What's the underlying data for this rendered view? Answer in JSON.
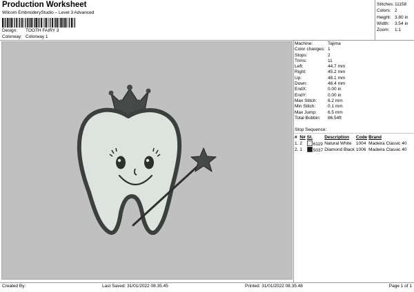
{
  "header": {
    "title": "Production Worksheet",
    "subtitle": "Wilcom EmbroideryStudio – Level 3 Advanced"
  },
  "design": {
    "label": "Design:",
    "value": "TOOTH FAIRY 3"
  },
  "colorway": {
    "label": "Colorway:",
    "value": "Colorway 1"
  },
  "stats": [
    {
      "label": "Stitches:",
      "value": "11158"
    },
    {
      "label": "Colors:",
      "value": "2"
    },
    {
      "label": "Height:",
      "value": "3.80 in"
    },
    {
      "label": "Width:",
      "value": "3.54 in"
    },
    {
      "label": "Zoom:",
      "value": "1:1"
    }
  ],
  "info": [
    {
      "label": "Machine:",
      "value": "Tajima"
    },
    {
      "label": "Color changes:",
      "value": "1"
    },
    {
      "label": "Stops:",
      "value": "2"
    },
    {
      "label": "Trims:",
      "value": "11"
    },
    {
      "label": "Left:",
      "value": "44.7 mm"
    },
    {
      "label": "Right:",
      "value": "45.2 mm"
    },
    {
      "label": "Up:",
      "value": "48.1 mm"
    },
    {
      "label": "Down:",
      "value": "48.4 mm"
    },
    {
      "label": "EndX:",
      "value": "0.00 in"
    },
    {
      "label": "EndY:",
      "value": "0.00 in"
    },
    {
      "label": "Max Stitch:",
      "value": "6.2 mm"
    },
    {
      "label": "Min Stitch:",
      "value": "0.1 mm"
    },
    {
      "label": "Max Jump:",
      "value": "6.5 mm"
    },
    {
      "label": "Total Bobbin:",
      "value": "86.54ft"
    }
  ],
  "stop_sequence": {
    "label": "Stop Sequence:",
    "headers": [
      "#",
      "N#",
      "St.",
      "Description",
      "Code",
      "Brand"
    ],
    "rows": [
      {
        "num": "1.",
        "n": "2",
        "swatch": "#e8ede6",
        "st": "6119",
        "desc": "Natural White",
        "code": "1004",
        "brand": "Madeira Classic 40"
      },
      {
        "num": "2.",
        "n": "1",
        "swatch": "#1a1a1a",
        "st": "5037",
        "desc": "Diamond Black",
        "code": "1006",
        "brand": "Madeira Classic 40"
      }
    ]
  },
  "footer": {
    "created_by": "Created By:",
    "last_saved": "Last Saved: 31/01/2022 08.35.45",
    "printed": "Printed: 31/01/2022 08.35.48",
    "page": "Page 1 of 1"
  }
}
